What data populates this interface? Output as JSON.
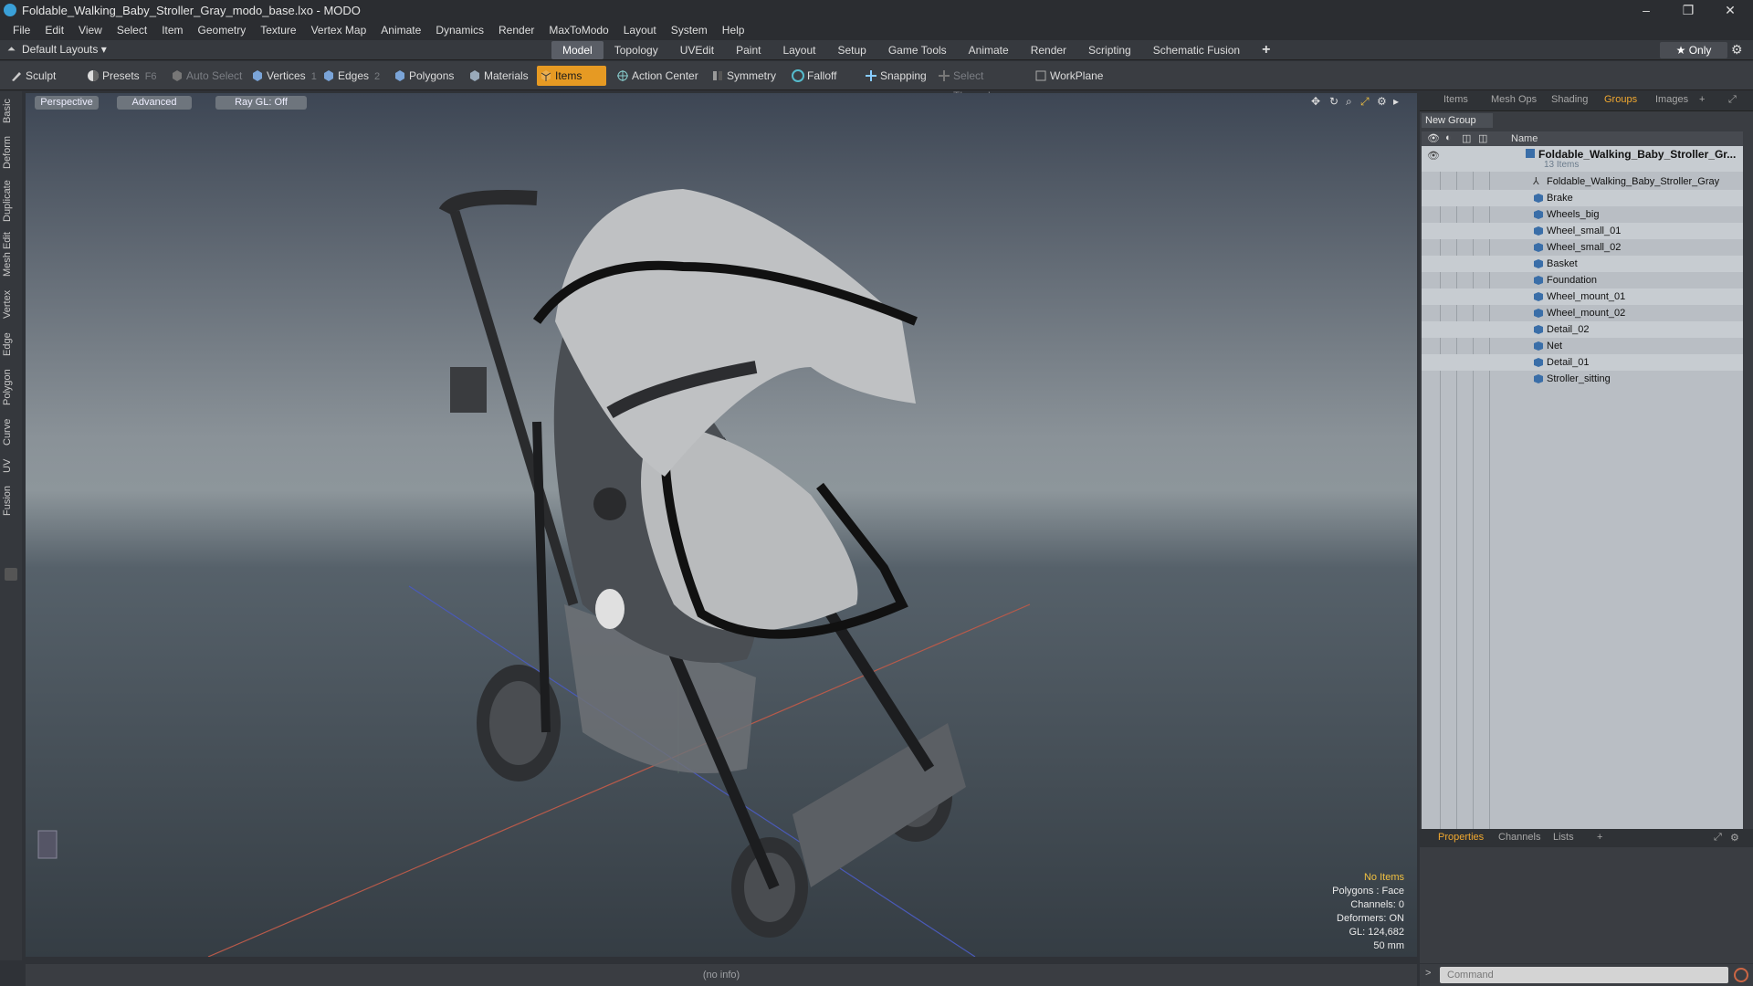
{
  "window": {
    "title": "Foldable_Walking_Baby_Stroller_Gray_modo_base.lxo - MODO"
  },
  "menu": [
    "File",
    "Edit",
    "View",
    "Select",
    "Item",
    "Geometry",
    "Texture",
    "Vertex Map",
    "Animate",
    "Dynamics",
    "Render",
    "MaxToModo",
    "Layout",
    "System",
    "Help"
  ],
  "layout": {
    "selector": "Default Layouts ▾",
    "tabs": [
      "Model",
      "Topology",
      "UVEdit",
      "Paint",
      "Layout",
      "Setup",
      "Game Tools",
      "Animate",
      "Render",
      "Scripting",
      "Schematic Fusion"
    ],
    "active_tab": "Model",
    "only_label": "★  Only"
  },
  "toolbar": {
    "sculpt": "Sculpt",
    "presets": "Presets",
    "presets_key": "F6",
    "auto_select": "Auto Select",
    "vertices": "Vertices",
    "vertices_key": "1",
    "edges": "Edges",
    "edges_key": "2",
    "polygons": "Polygons",
    "materials": "Materials",
    "items": "Items",
    "action_center": "Action Center",
    "symmetry": "Symmetry",
    "falloff": "Falloff",
    "snapping": "Snapping",
    "select_through": "Select Through",
    "workplane": "WorkPlane"
  },
  "left_tabs": [
    "Basic",
    "Deform",
    "Duplicate",
    "Mesh Edit",
    "Vertex",
    "Edge",
    "Polygon",
    "Curve",
    "UV",
    "Fusion"
  ],
  "viewport": {
    "perspective": "Perspective",
    "advanced": "Advanced",
    "raygl": "Ray GL: Off",
    "hud": {
      "selection": "No Items",
      "polygons": "Polygons : Face",
      "channels": "Channels: 0",
      "deformers": "Deformers: ON",
      "gl": "GL: 124,682",
      "scale": "50 mm"
    }
  },
  "right_panel": {
    "tabs": [
      "Items",
      "Mesh Ops",
      "Shading",
      "Groups",
      "Images"
    ],
    "active_tab": "Groups",
    "new_group": "New Group",
    "column_name": "Name",
    "group_name": "Foldable_Walking_Baby_Stroller_Gr...",
    "group_count": "13 Items",
    "items": [
      "Foldable_Walking_Baby_Stroller_Gray",
      "Brake",
      "Wheels_big",
      "Wheel_small_01",
      "Wheel_small_02",
      "Basket",
      "Foundation",
      "Wheel_mount_01",
      "Wheel_mount_02",
      "Detail_02",
      "Net",
      "Detail_01",
      "Stroller_sitting"
    ],
    "bottom_tabs": [
      "Properties",
      "Channels",
      "Lists"
    ],
    "bottom_active": "Properties"
  },
  "status": {
    "info": "(no info)",
    "command_placeholder": "Command"
  },
  "colors": {
    "accent": "#e69a23",
    "active_tab_text": "#f0a830",
    "viewport_top": "#3d4654",
    "viewport_bottom": "#353d44"
  }
}
